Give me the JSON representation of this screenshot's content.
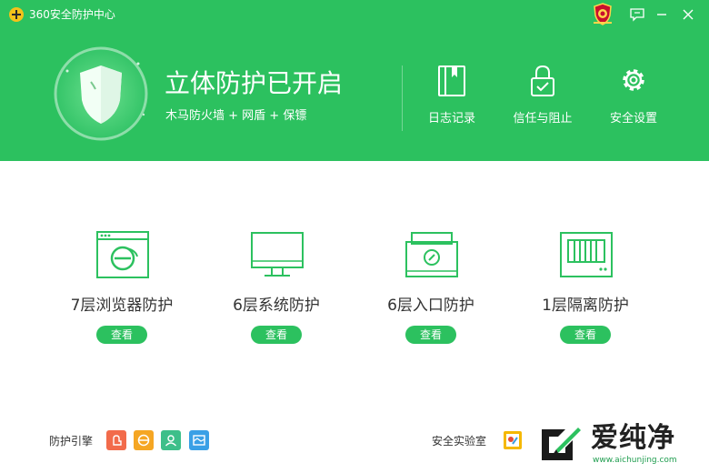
{
  "app": {
    "title": "360安全防护中心",
    "accent_color": "#2cc15f"
  },
  "titlebar": {
    "badge_icon": "guardian-badge-icon",
    "buttons": [
      "chat-icon",
      "minimize-icon",
      "close-icon"
    ]
  },
  "status": {
    "headline": "立体防护已开启",
    "subline": "木马防火墙 + 网盾 + 保镖",
    "shield_icon": "shield-icon"
  },
  "header_actions": [
    {
      "label": "日志记录",
      "icon": "log-book-icon"
    },
    {
      "label": "信任与阻止",
      "icon": "lock-check-icon"
    },
    {
      "label": "安全设置",
      "icon": "gear-icon"
    }
  ],
  "features": [
    {
      "title": "7层浏览器防护",
      "button": "查看",
      "icon": "browser-icon"
    },
    {
      "title": "6层系统防护",
      "button": "查看",
      "icon": "monitor-icon"
    },
    {
      "title": "6层入口防护",
      "button": "查看",
      "icon": "entrance-icon"
    },
    {
      "title": "1层隔离防护",
      "button": "查看",
      "icon": "isolation-icon"
    }
  ],
  "footer": {
    "engine_label": "防护引擎",
    "engines": [
      {
        "icon": "engine-hand-icon",
        "color": "#f26b4b"
      },
      {
        "icon": "engine-e-icon",
        "color": "#f5a623"
      },
      {
        "icon": "engine-user-icon",
        "color": "#3dbf8a"
      },
      {
        "icon": "engine-card-icon",
        "color": "#3aa0e6"
      }
    ],
    "lab_label": "安全实验室",
    "lab_icon": "lab-icon"
  },
  "watermark": {
    "title": "爱纯净",
    "url": "www.aichunjing.com"
  }
}
